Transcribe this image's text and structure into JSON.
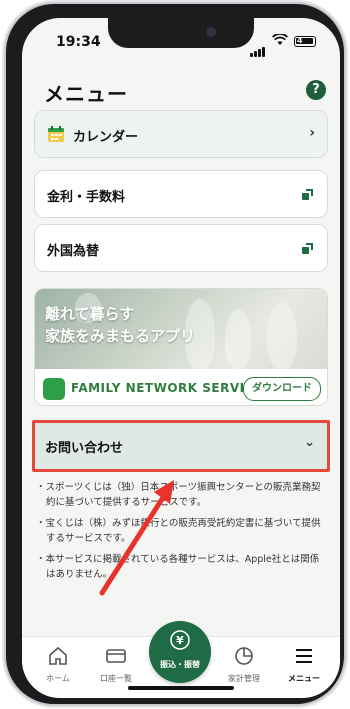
{
  "status_bar": {
    "time": "19:34",
    "battery": "4"
  },
  "header": {
    "title": "メニュー",
    "help_label": "?"
  },
  "menu": {
    "calendar_label": "カレンダー",
    "rates_label": "金利・手数料",
    "fx_label": "外国為替"
  },
  "banner": {
    "headline_line1": "離れて暮らす",
    "headline_line2": "家族をみまもるアプリ",
    "service_name": "FAMILY NETWORK SERVICE",
    "download_label": "ダウンロード"
  },
  "contact": {
    "label": "お問い合わせ"
  },
  "notes": [
    "・スポーツくじは（独）日本スポーツ振興センターとの販売業務契約に基づいて提供するサービスです。",
    "・宝くじは（株）みずほ銀行との販売再受託約定書に基づいて提供するサービスです。",
    "・本サービスに掲載されている各種サービスは、Apple社とは関係はありません。"
  ],
  "tabbar": {
    "home": "ホーム",
    "accounts": "口座一覧",
    "transfer": "振込・振替",
    "budget": "家計管理",
    "menu": "メニュー"
  },
  "colors": {
    "brand_green": "#1e6b45",
    "highlight_red": "#e5473a",
    "arrow_red": "#e8322b"
  }
}
